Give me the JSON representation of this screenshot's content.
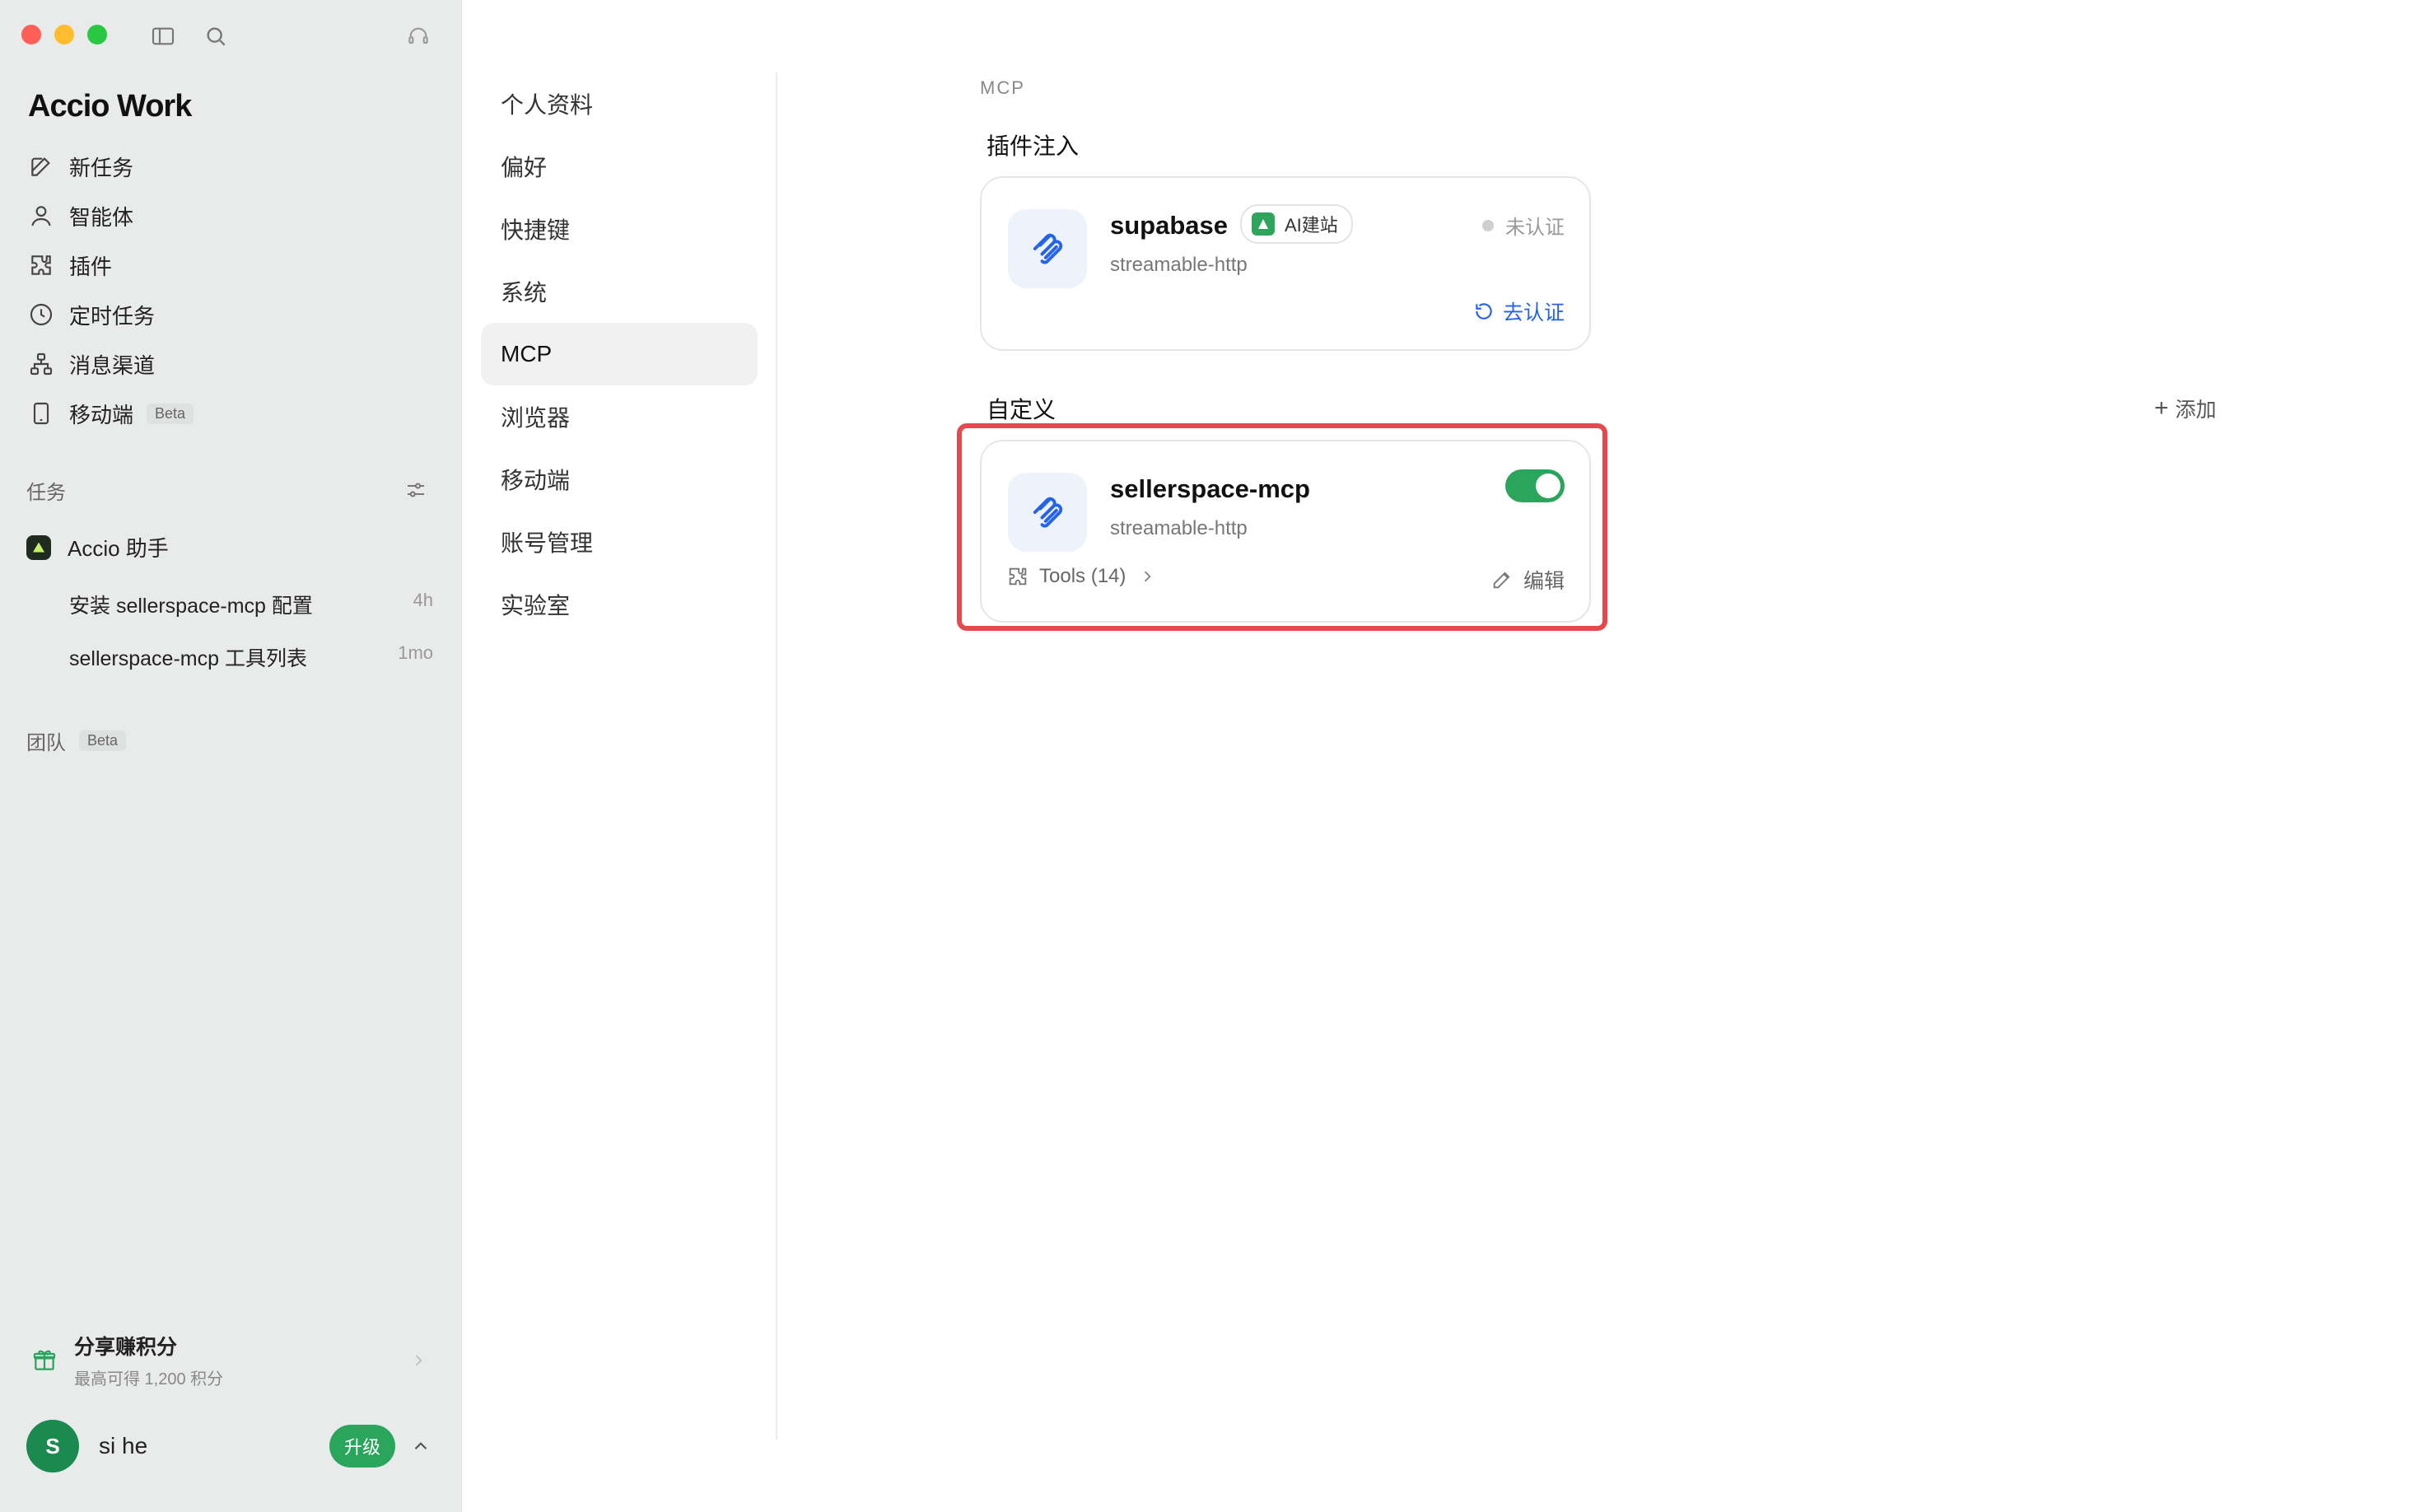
{
  "sidebar": {
    "brand": "Accio Work",
    "nav": [
      {
        "label": "新任务",
        "icon": "edit-icon"
      },
      {
        "label": "智能体",
        "icon": "person-icon"
      },
      {
        "label": "插件",
        "icon": "puzzle-icon"
      },
      {
        "label": "定时任务",
        "icon": "clock-icon"
      },
      {
        "label": "消息渠道",
        "icon": "network-icon"
      },
      {
        "label": "移动端",
        "icon": "phone-icon",
        "badge": "Beta"
      }
    ],
    "tasks_label": "任务",
    "assistant": "Accio 助手",
    "tasks": [
      {
        "title": "安装 sellerspace-mcp 配置",
        "time": "4h"
      },
      {
        "title": "sellerspace-mcp 工具列表",
        "time": "1mo"
      }
    ],
    "team_label": "团队",
    "team_badge": "Beta",
    "share": {
      "title": "分享赚积分",
      "subtitle": "最高可得 1,200 积分"
    },
    "user": {
      "initial": "S",
      "name": "si he",
      "upgrade": "升级"
    }
  },
  "settings_nav": [
    {
      "label": "个人资料"
    },
    {
      "label": "偏好"
    },
    {
      "label": "快捷键"
    },
    {
      "label": "系统"
    },
    {
      "label": "MCP",
      "active": true
    },
    {
      "label": "浏览器"
    },
    {
      "label": "移动端"
    },
    {
      "label": "账号管理"
    },
    {
      "label": "实验室"
    }
  ],
  "main": {
    "page_label": "MCP",
    "plugin_section": "插件注入",
    "custom_section": "自定义",
    "add_label": "添加",
    "plugin_card": {
      "name": "supabase",
      "tag": "AI建站",
      "type": "streamable-http",
      "status": "未认证",
      "auth_action": "去认证"
    },
    "custom_card": {
      "name": "sellerspace-mcp",
      "type": "streamable-http",
      "enabled": true,
      "tools_label": "Tools (14)",
      "edit_label": "编辑"
    }
  },
  "colors": {
    "accent_green": "#2aa55c",
    "link_blue": "#2463eb",
    "highlight_red": "#e5484d",
    "sidebar_bg": "#e9ebea"
  }
}
